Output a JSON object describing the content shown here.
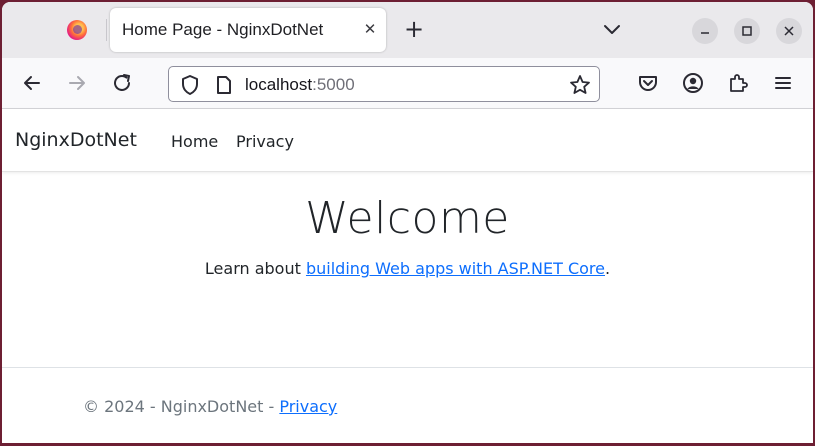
{
  "browser": {
    "tab_title": "Home Page - NginxDotNet",
    "url_host": "localhost",
    "url_port": ":5000"
  },
  "site": {
    "brand": "NginxDotNet",
    "nav": [
      "Home",
      "Privacy"
    ],
    "heading": "Welcome",
    "learn_prefix": "Learn about ",
    "learn_link": "building Web apps with ASP.NET Core",
    "learn_suffix": ".",
    "footer_text": "© 2024 - NginxDotNet - ",
    "footer_link": "Privacy"
  },
  "icons": {
    "firefox": "firefox-logo-icon",
    "close_tab": "close-icon",
    "new_tab": "plus-icon",
    "list_tabs": "chevron-down-icon",
    "minimize": "minimize-icon",
    "maximize": "maximize-icon",
    "close_window": "close-icon",
    "back": "arrow-left-icon",
    "forward": "arrow-right-icon",
    "reload": "reload-icon",
    "shield": "shield-icon",
    "page": "page-icon",
    "bookmark": "star-icon",
    "pocket": "pocket-icon",
    "account": "account-icon",
    "extensions": "puzzle-icon",
    "menu": "hamburger-menu-icon"
  },
  "colors": {
    "link": "#0d6efd",
    "desktop_bg": "#6d1f33",
    "tabstrip_bg": "#eae9ec",
    "footer_text": "#6c757d"
  }
}
